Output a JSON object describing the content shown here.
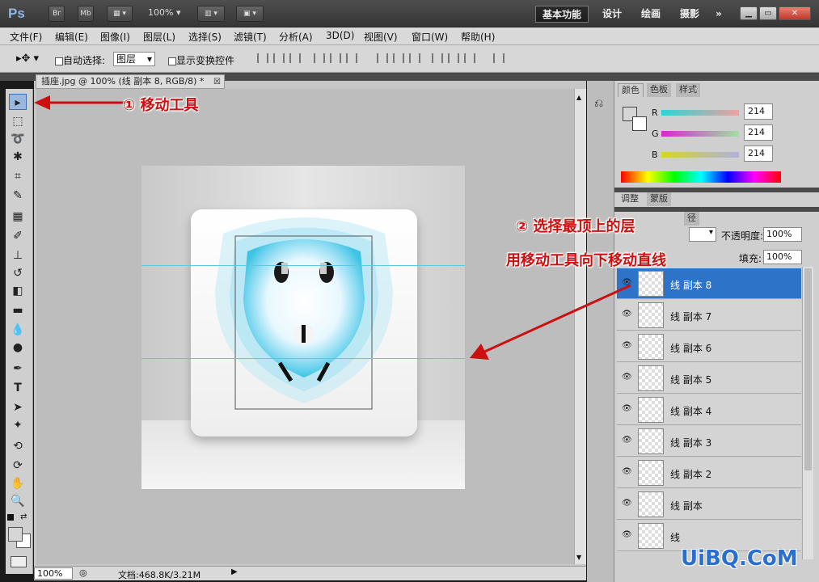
{
  "app": {
    "logo": "Ps",
    "bridge_label": "Br",
    "minibridge_label": "Mb",
    "zoom": "100%",
    "workspaces": [
      "基本功能",
      "设计",
      "绘画",
      "摄影"
    ],
    "more": "»"
  },
  "menu": [
    "文件(F)",
    "编辑(E)",
    "图像(I)",
    "图层(L)",
    "选择(S)",
    "滤镜(T)",
    "分析(A)",
    "3D(D)",
    "视图(V)",
    "窗口(W)",
    "帮助(H)"
  ],
  "options": {
    "auto_select_label": "自动选择:",
    "auto_select_value": "图层",
    "show_transform_label": "显示变换控件"
  },
  "document": {
    "tab_title": "插座.jpg @ 100% (线 副本 8, RGB/8) *",
    "status_zoom": "100%",
    "status_doc": "文档:468.8K/3.21M"
  },
  "color_panel": {
    "tabs": [
      "颜色",
      "色板",
      "样式"
    ],
    "channels": [
      {
        "label": "R",
        "value": "214"
      },
      {
        "label": "G",
        "value": "214"
      },
      {
        "label": "B",
        "value": "214"
      }
    ]
  },
  "adjust_panel": {
    "tabs": [
      "调整",
      "蒙版"
    ]
  },
  "layers_panel": {
    "tab_partial": "径",
    "opacity_label": "不透明度:",
    "opacity_value": "100%",
    "fill_label": "填充:",
    "fill_value": "100%",
    "layers": [
      {
        "name": "线 副本 8",
        "selected": true
      },
      {
        "name": "线 副本 7",
        "selected": false
      },
      {
        "name": "线 副本 6",
        "selected": false
      },
      {
        "name": "线 副本 5",
        "selected": false
      },
      {
        "name": "线 副本 4",
        "selected": false
      },
      {
        "name": "线 副本 3",
        "selected": false
      },
      {
        "name": "线 副本 2",
        "selected": false
      },
      {
        "name": "线 副本",
        "selected": false
      },
      {
        "name": "线",
        "selected": false
      }
    ]
  },
  "annotations": {
    "step1": "① 移动工具",
    "step2_line1": "② 选择最顶上的层",
    "step2_line2": "用移动工具向下移动直线"
  },
  "watermark": "UiBQ.CoM",
  "colors": {
    "selected_layer": "#2d74c9",
    "annotation_red": "#cc1010",
    "guide_cyan": "#5fc8e0",
    "watermark_blue": "#2a6fd0"
  }
}
